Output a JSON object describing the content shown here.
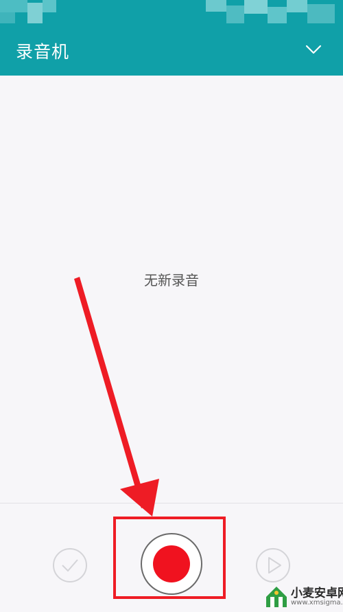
{
  "header": {
    "title": "录音机",
    "menu_icon": "chevron-down-icon"
  },
  "main": {
    "empty_state_text": "无新录音"
  },
  "toolbar": {
    "confirm_icon": "check-icon",
    "record_icon": "record-icon",
    "play_icon": "play-icon"
  },
  "colors": {
    "accent": "#10a0a8",
    "record_red": "#f0121f",
    "annotation_red": "#ee1c25",
    "background": "#f7f6f9"
  },
  "watermark": {
    "name": "小麦安卓网",
    "url": "www.xmsigma.com"
  }
}
